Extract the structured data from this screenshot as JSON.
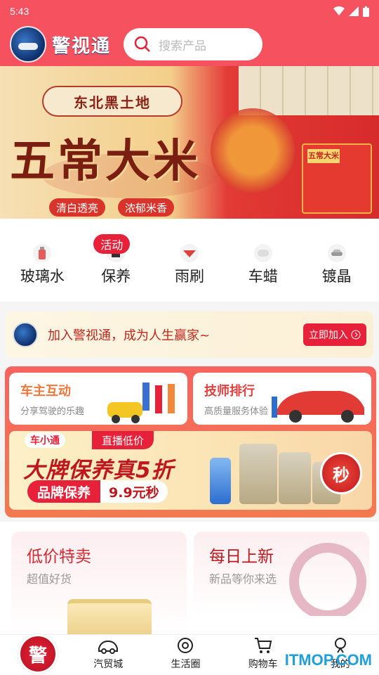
{
  "status": {
    "time": "5:43"
  },
  "header": {
    "brand": "警视通",
    "search_placeholder": "搜索产品"
  },
  "banner": {
    "tag": "东北黑土地",
    "title": "五常大米",
    "chips": [
      "清白透亮",
      "浓郁米香"
    ],
    "box_label": "五常大米"
  },
  "categories": [
    {
      "label": "玻璃水"
    },
    {
      "label": "保养",
      "badge": "活动"
    },
    {
      "label": "雨刷"
    },
    {
      "label": "车蜡"
    },
    {
      "label": "镀晶"
    }
  ],
  "join": {
    "text": "加入警视通，成为人生赢家~",
    "button": "立即加入"
  },
  "promo": {
    "card1": {
      "title": "车主互动",
      "subtitle": "分享驾驶的乐趣"
    },
    "card2": {
      "title": "技师排行",
      "subtitle": "高质量服务体验"
    },
    "live": {
      "car_tag": "车小通",
      "live_tag": "直播低价",
      "headline": "大牌保养真5折",
      "brand_tag": "品牌保养",
      "price": "9.9元秒",
      "seckill": "秒"
    }
  },
  "tiles": {
    "t1": {
      "title": "低价特卖",
      "subtitle": "超值好货"
    },
    "t2": {
      "title": "每日上新",
      "subtitle": "新品等你来选"
    }
  },
  "tabbar": {
    "home": "警",
    "items": [
      "汽贸城",
      "生活圈",
      "购物车",
      "我的"
    ]
  },
  "watermark": "ITMOP.COM"
}
